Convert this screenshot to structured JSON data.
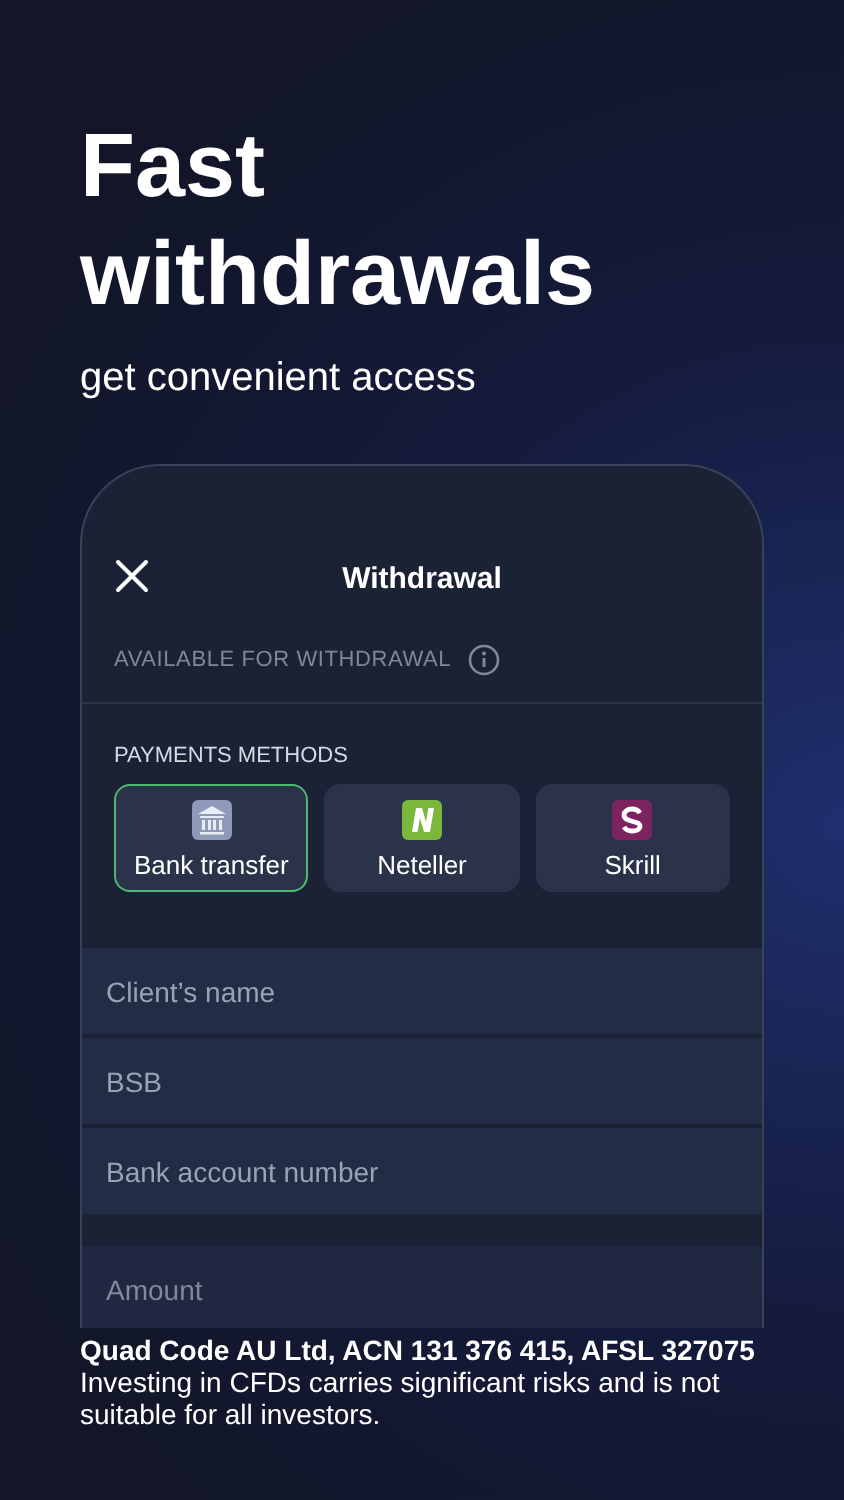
{
  "headline": "Fast withdrawals",
  "subtitle": "get convenient access",
  "screen": {
    "title": "Withdrawal",
    "available_label": "AVAILABLE FOR WITHDRAWAL",
    "methods_label": "PAYMENTS METHODS",
    "methods": [
      {
        "label": "Bank transfer",
        "kind": "bank",
        "selected": true
      },
      {
        "label": "Neteller",
        "kind": "neteller",
        "selected": false
      },
      {
        "label": "Skrill",
        "kind": "skrill",
        "selected": false
      }
    ],
    "fields": [
      {
        "placeholder": "Client’s name"
      },
      {
        "placeholder": "BSB"
      },
      {
        "placeholder": "Bank account number"
      }
    ],
    "amount_field": {
      "placeholder": "Amount"
    }
  },
  "legal": {
    "entity": "Quad Code AU Ltd, ACN 131 376 415, AFSL 327075",
    "disclaimer": "Investing in CFDs carries significant risks and is not suitable for all investors."
  }
}
